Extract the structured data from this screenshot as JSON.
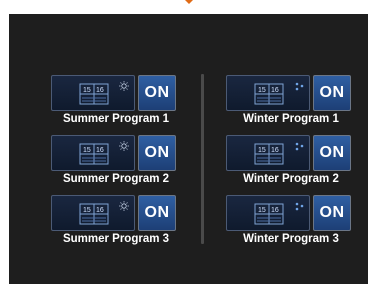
{
  "colors": {
    "screen_bg": "#1e1e1e",
    "accent": "#e06b16",
    "on_button": "#2a5596",
    "schedule_bg": "#132038"
  },
  "programs": {
    "summer": [
      {
        "label": "Summer Program 1",
        "button": "ON",
        "icon": "sun-icon"
      },
      {
        "label": "Summer Program 2",
        "button": "ON",
        "icon": "sun-icon"
      },
      {
        "label": "Summer Program 3",
        "button": "ON",
        "icon": "sun-icon"
      }
    ],
    "winter": [
      {
        "label": "Winter Program 1",
        "button": "ON",
        "icon": "snowflake-icon"
      },
      {
        "label": "Winter Program 2",
        "button": "ON",
        "icon": "snowflake-icon"
      },
      {
        "label": "Winter Program 3",
        "button": "ON",
        "icon": "snowflake-icon"
      }
    ]
  },
  "schedule": {
    "start_hour": "15",
    "end_hour": "16"
  }
}
